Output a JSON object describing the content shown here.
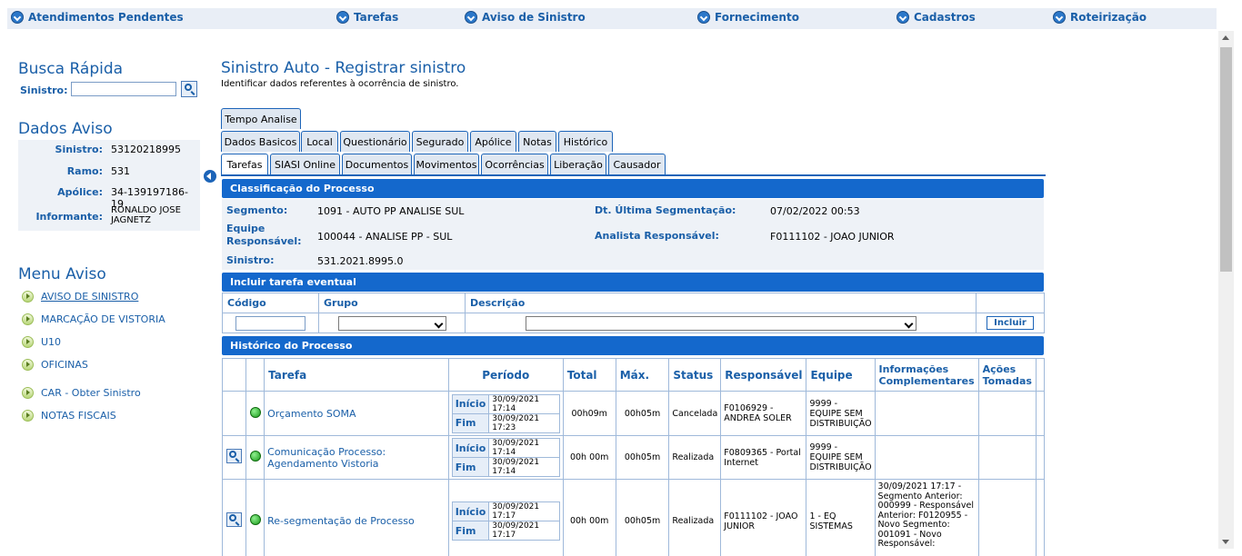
{
  "topnav": [
    "Atendimentos Pendentes",
    "Tarefas",
    "Aviso de Sinistro",
    "Fornecimento",
    "Cadastros",
    "Roteirização"
  ],
  "sidebar": {
    "busca_title": "Busca Rápida",
    "busca_label": "Sinistro:",
    "busca_value": "",
    "dados_title": "Dados Aviso",
    "dados": [
      {
        "label": "Sinistro:",
        "value": "53120218995"
      },
      {
        "label": "Ramo:",
        "value": "531"
      },
      {
        "label": "Apólice:",
        "value": "34-139197186-19"
      },
      {
        "label": "Informante:",
        "value": "RONALDO JOSE JAGNETZ"
      }
    ],
    "menu_title": "Menu Aviso",
    "menu": [
      "AVISO DE SINISTRO",
      "MARCAÇÃO DE VISTORIA",
      "U10",
      "OFICINAS",
      "CAR - Obter Sinistro",
      "NOTAS FISCAIS"
    ]
  },
  "main": {
    "title": "Sinistro Auto - Registrar sinistro",
    "subtitle": "Identificar dados referentes à ocorrência de sinistro.",
    "tabs_row1": [
      "Tempo Analise"
    ],
    "tabs_row2": [
      "Dados Basicos",
      "Local",
      "Questionário",
      "Segurado",
      "Apólice",
      "Notas",
      "Histórico"
    ],
    "tabs_row3": [
      "Tarefas",
      "SIASI Online",
      "Documentos",
      "Movimentos",
      "Ocorrências",
      "Liberação",
      "Causador"
    ],
    "active_tab": "Tarefas"
  },
  "classificacao": {
    "header": "Classificação do Processo",
    "segmento_label": "Segmento:",
    "segmento": "1091 - AUTO PP ANALISE SUL",
    "equipe_label": "Equipe Responsável:",
    "equipe": "100044 - ANALISE PP - SUL",
    "sinistro_label": "Sinistro:",
    "sinistro": "531.2021.8995.0",
    "dt_label": "Dt. Última Segmentação:",
    "dt": "07/02/2022 00:53",
    "analista_label": "Analista Responsável:",
    "analista": "F0111102 - JOAO JUNIOR"
  },
  "incluir": {
    "header": "Incluir tarefa eventual",
    "col_codigo": "Código",
    "col_grupo": "Grupo",
    "col_descricao": "Descrição",
    "button": "Incluir"
  },
  "historico": {
    "header": "Histórico do Processo",
    "columns": {
      "tarefa": "Tarefa",
      "periodo": "Período",
      "total": "Total",
      "max": "Máx.",
      "status": "Status",
      "responsavel": "Responsável",
      "equipe": "Equipe",
      "info": "Informações Complementares",
      "acoes": "Ações Tomadas"
    },
    "inicio_label": "Início",
    "fim_label": "Fim",
    "rows": [
      {
        "tarefa": "Orçamento SOMA",
        "inicio": "30/09/2021 17:14",
        "fim": "30/09/2021 17:23",
        "total": "00h09m",
        "max": "00h05m",
        "status": "Cancelada",
        "responsavel": "F0106929 - ANDREA SOLER",
        "equipe": "9999 - EQUIPE SEM DISTRIBUIÇÃO",
        "info": "",
        "acoes": ""
      },
      {
        "tarefa": "Comunicação Processo: Agendamento Vistoria",
        "inicio": "30/09/2021 17:14",
        "fim": "30/09/2021 17:14",
        "total": "00h 00m",
        "max": "00h05m",
        "status": "Realizada",
        "responsavel": "F0809365 - Portal Internet",
        "equipe": "9999 - EQUIPE SEM DISTRIBUIÇÃO",
        "info": "",
        "acoes": ""
      },
      {
        "tarefa": "Re-segmentação de Processo",
        "inicio": "30/09/2021 17:17",
        "fim": "30/09/2021 17:17",
        "total": "00h 00m",
        "max": "00h05m",
        "status": "Realizada",
        "responsavel": "F0111102 - JOAO JUNIOR",
        "equipe": "1 - EQ SISTEMAS",
        "info": "30/09/2021 17:17 - Segmento Anterior: 000999 - Responsável Anterior: F0120955 - Novo Segmento: 001091 - Novo Responsável:",
        "acoes": ""
      }
    ]
  }
}
